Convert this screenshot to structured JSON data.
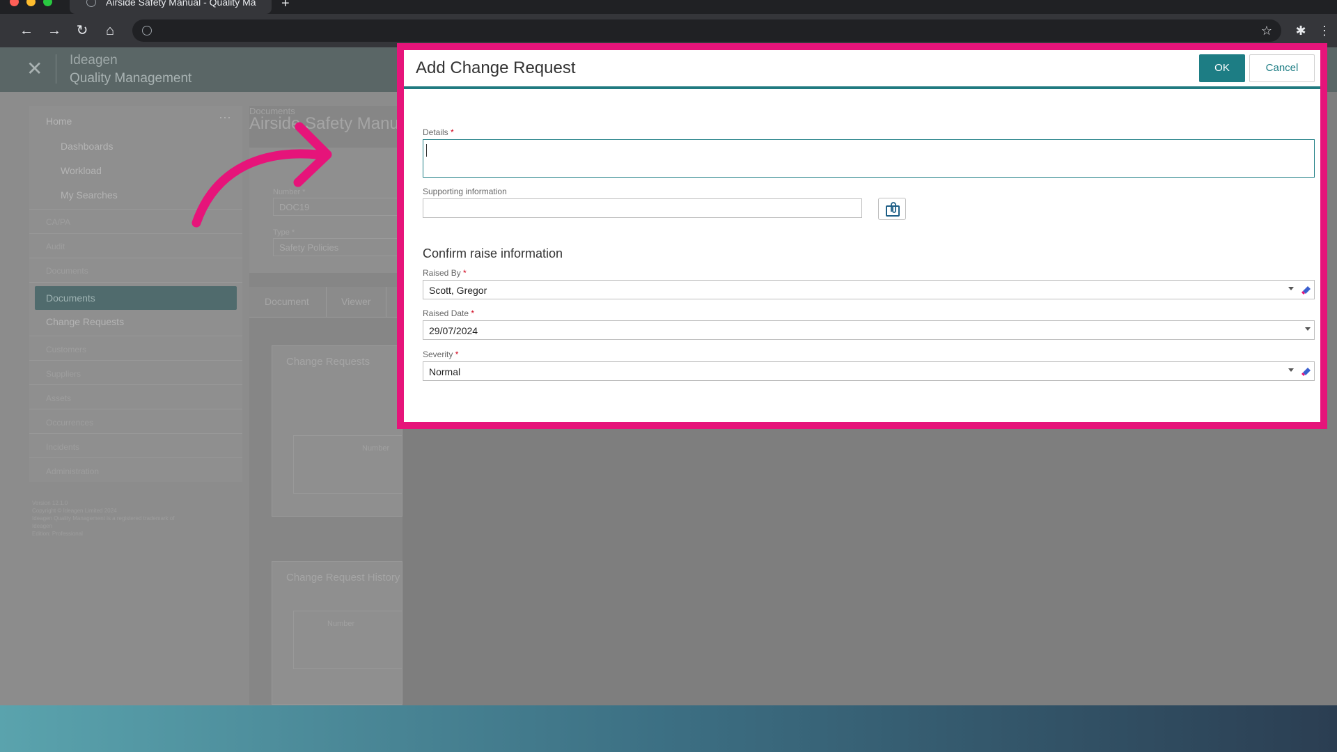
{
  "browser": {
    "tab_title": "Airside Safety Manual - Quality Ma",
    "new_tab": "+",
    "back": "←",
    "forward": "→",
    "reload": "↻",
    "home": "⌂",
    "star": "☆",
    "extensions": "✱",
    "menu": "⋮"
  },
  "app": {
    "close": "✕",
    "brand_line1": "Ideagen",
    "brand_line2": "Quality Management",
    "sidebar": {
      "home": "Home",
      "more": "···",
      "sub_items": [
        "Dashboards",
        "Workload",
        "My Searches"
      ],
      "groups": [
        "CA/PA",
        "Audit",
        "Documents"
      ],
      "active": "Documents",
      "change_requests": "Change Requests",
      "groups2": [
        "Customers",
        "Suppliers",
        "Assets",
        "Occurrences",
        "Incidents",
        "Administration"
      ],
      "footer": [
        "Version 12.1.0",
        "Copyright © Ideagen Limited 2024",
        "Ideagen Quality Management is a registered trademark of",
        "Ideagen",
        "Edition: Professional"
      ]
    },
    "content": {
      "breadcrumb": "Documents",
      "title": "Airside Safety Manual",
      "number_label": "Number *",
      "number_value": "DOC19",
      "type_label": "Type *",
      "type_value": "Safety Policies",
      "tabs": [
        "Document",
        "Viewer"
      ],
      "panel1_title": "Change Requests",
      "panel1_col": "Number",
      "panel2_title": "Change Request History",
      "panel2_col": "Number"
    }
  },
  "dialog": {
    "title": "Add Change Request",
    "ok": "OK",
    "cancel": "Cancel",
    "details_label": "Details",
    "supporting_label": "Supporting information",
    "section_title": "Confirm raise information",
    "raised_by_label": "Raised By",
    "raised_by_value": "Scott, Gregor",
    "raised_date_label": "Raised Date",
    "raised_date_value": "29/07/2024",
    "severity_label": "Severity",
    "severity_value": "Normal",
    "required_mark": "*"
  },
  "colors": {
    "highlight": "#e6147a",
    "accent": "#1d7d84"
  }
}
